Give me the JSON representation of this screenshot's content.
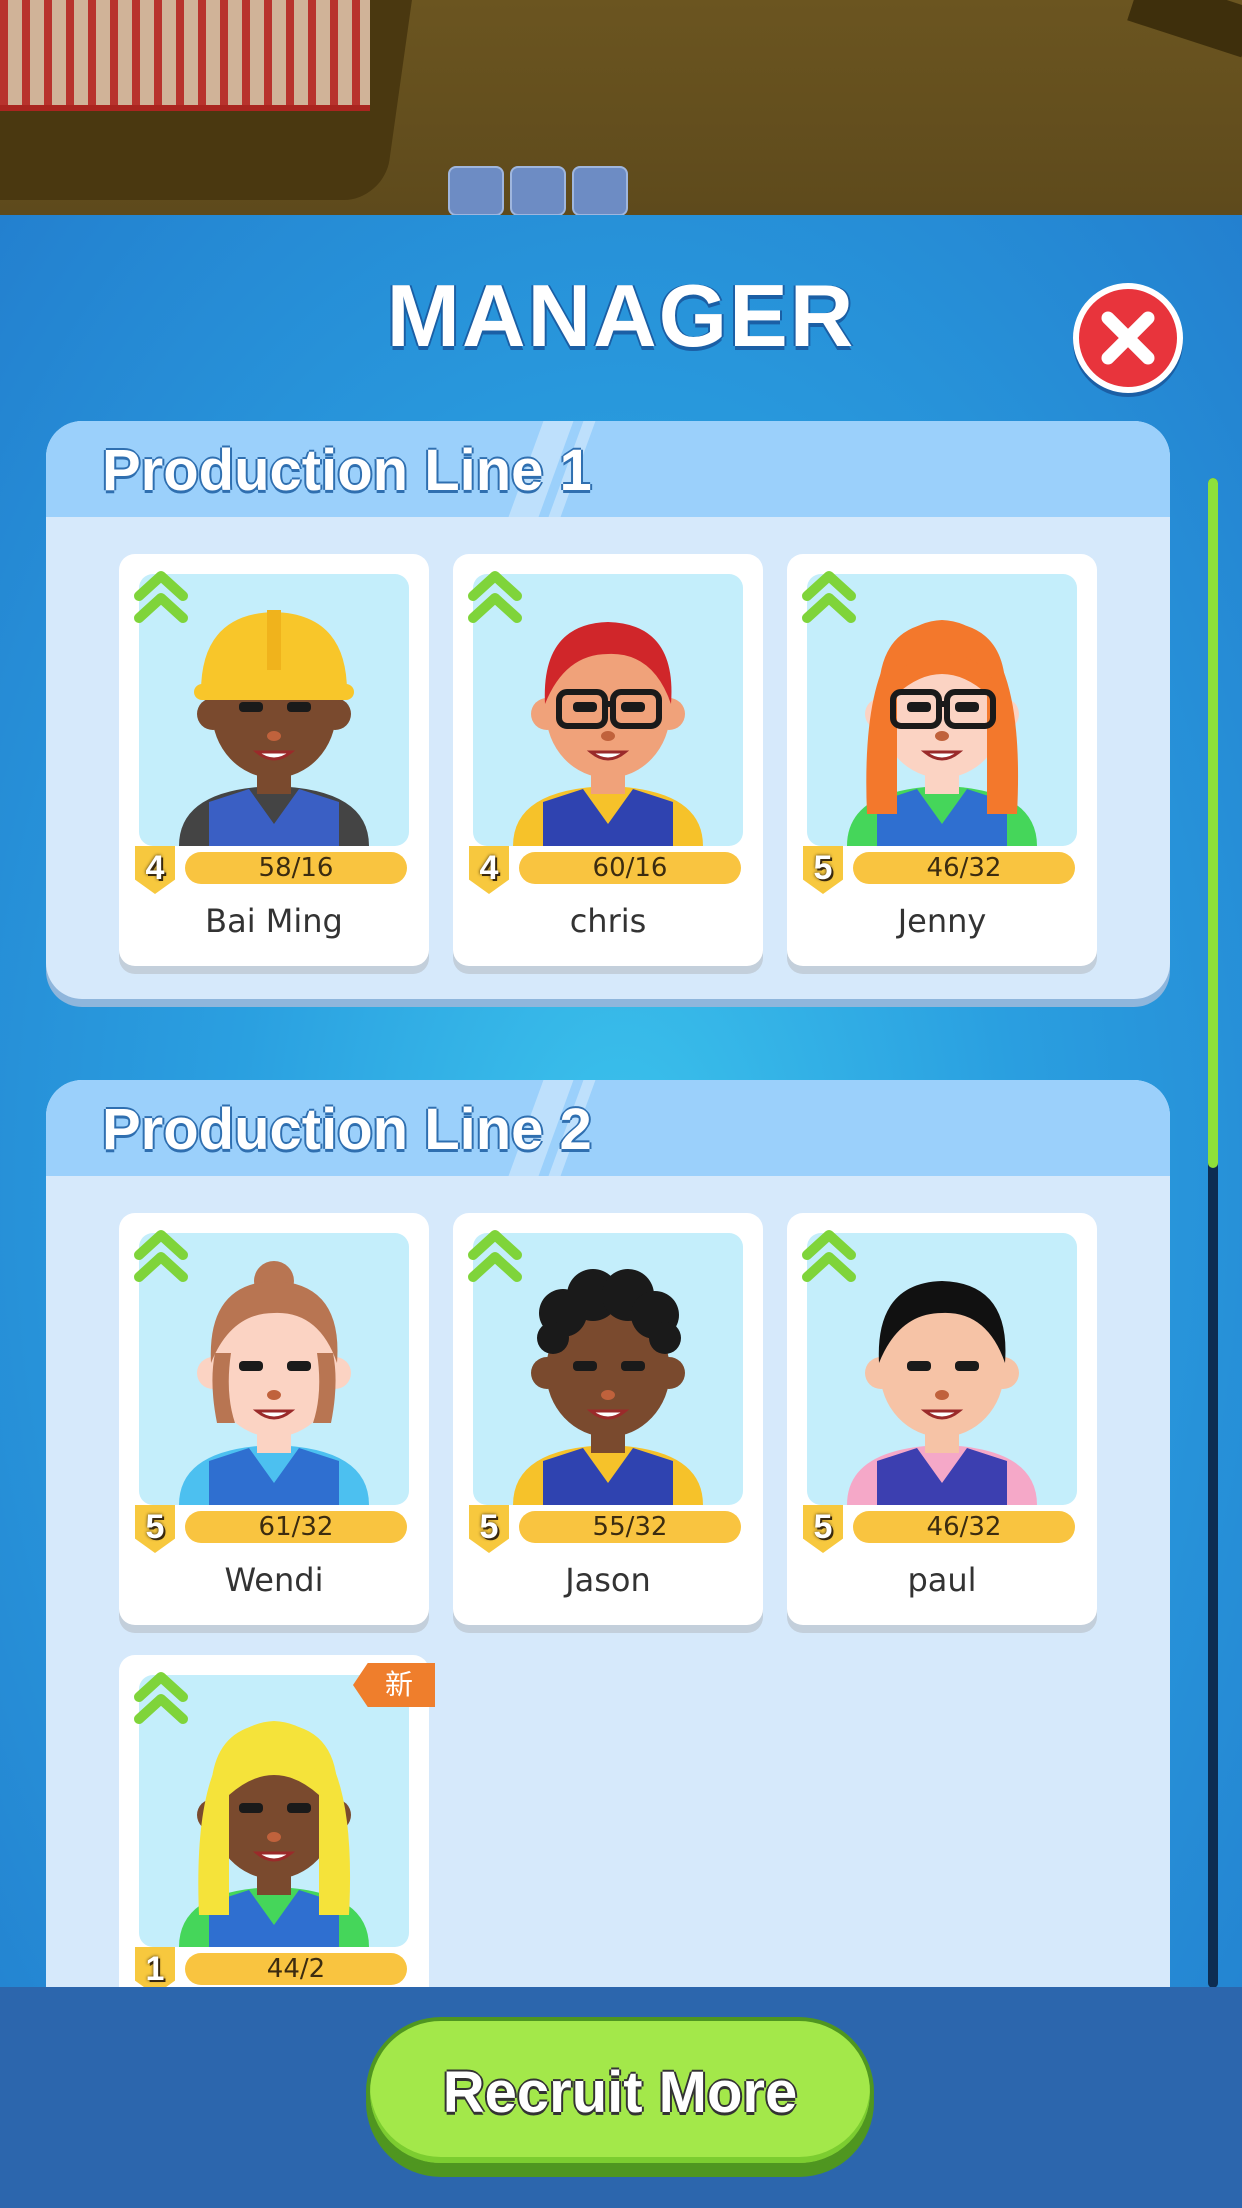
{
  "title": "MANAGER",
  "sections": [
    {
      "title": "Production Line 1",
      "managers": [
        {
          "name": "Bai Ming",
          "level": "4",
          "progress": "58/16",
          "new": false
        },
        {
          "name": "chris",
          "level": "4",
          "progress": "60/16",
          "new": false
        },
        {
          "name": "Jenny",
          "level": "5",
          "progress": "46/32",
          "new": false
        }
      ]
    },
    {
      "title": "Production Line 2",
      "managers": [
        {
          "name": "Wendi",
          "level": "5",
          "progress": "61/32",
          "new": false
        },
        {
          "name": "Jason",
          "level": "5",
          "progress": "55/32",
          "new": false
        },
        {
          "name": "paul",
          "level": "5",
          "progress": "46/32",
          "new": false
        },
        {
          "name": "",
          "level": "1",
          "progress": "44/2",
          "new": true,
          "badge": "新"
        }
      ]
    }
  ],
  "recruit_button": "Recruit More",
  "colors": {
    "accent_green": "#a3e84a",
    "close_red": "#e8343c",
    "panel_blue": "#2a9fe0",
    "level_yellow": "#f9c440"
  }
}
